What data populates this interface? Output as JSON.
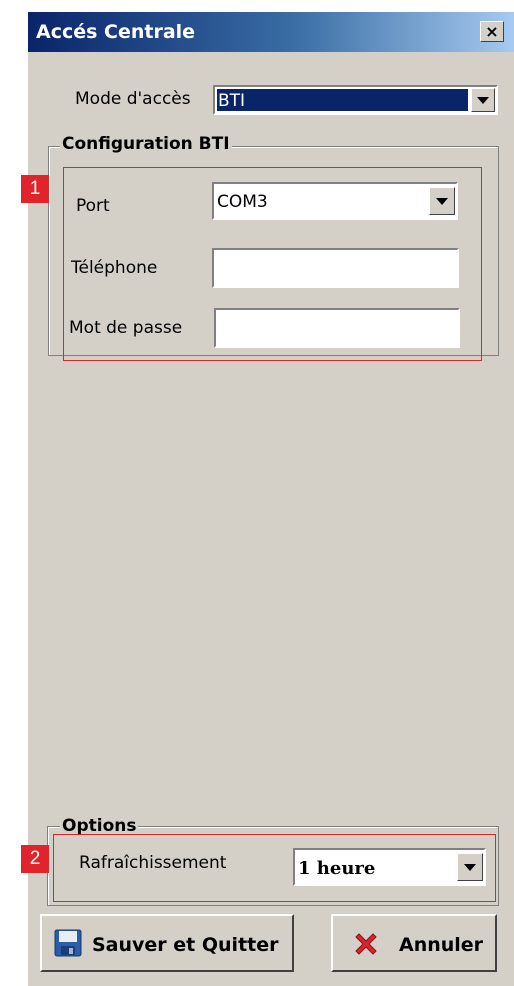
{
  "window": {
    "title": "Accés Centrale",
    "close_label": "×"
  },
  "access_mode": {
    "label": "Mode d'accès",
    "value": "BTI"
  },
  "config_group": {
    "title": "Configuration BTI",
    "port": {
      "label": "Port",
      "value": "COM3"
    },
    "phone": {
      "label": "Téléphone",
      "value": ""
    },
    "password": {
      "label": "Mot de passe",
      "value": ""
    }
  },
  "options_group": {
    "title": "Options",
    "refresh": {
      "label": "Rafraîchissement",
      "value": "1 heure"
    }
  },
  "buttons": {
    "save": "Sauver et Quitter",
    "cancel": "Annuler"
  },
  "markers": [
    "1",
    "2"
  ],
  "icons": {
    "save": "floppy-disk-icon",
    "cancel": "red-x-icon"
  },
  "colors": {
    "highlight": "#e0242c",
    "selection": "#0a246a"
  }
}
